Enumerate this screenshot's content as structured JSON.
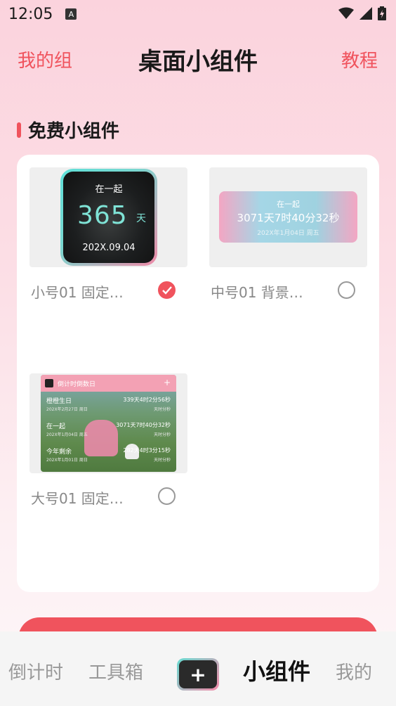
{
  "status": {
    "time": "12:05",
    "notif_icon": "A"
  },
  "header": {
    "left": "我的组",
    "title": "桌面小组件",
    "right": "教程"
  },
  "section": {
    "title": "免费小组件"
  },
  "widgets": [
    {
      "label": "小号01 固定…",
      "checked": true,
      "preview": {
        "top": "在一起",
        "number": "365",
        "unit": "天",
        "date": "202X.09.04"
      }
    },
    {
      "label": "中号01 背景…",
      "checked": false,
      "preview": {
        "top": "在一起",
        "main": "3071天7时40分32秒",
        "date": "202X年1月04日 周五"
      }
    },
    {
      "label": "大号01 固定…",
      "checked": false,
      "preview": {
        "header": "倒计时倒数日",
        "rows": [
          {
            "name": "橙橙生日",
            "value": "339天4时2分56秒",
            "sub": "202X年2月27日 周日",
            "sub2": "天时分秒"
          },
          {
            "name": "在一起",
            "value": "3071天7时40分32秒",
            "sub": "202X年1月04日 周五",
            "sub2": "天时分秒"
          },
          {
            "name": "今年剩余",
            "value": "282天4时3分15秒",
            "sub": "202X年1月01日 周日",
            "sub2": "天时分秒"
          }
        ]
      }
    }
  ],
  "nav": {
    "items": [
      "倒计时",
      "工具箱",
      "小组件",
      "我的"
    ],
    "add_label": "+",
    "active": "小组件"
  }
}
